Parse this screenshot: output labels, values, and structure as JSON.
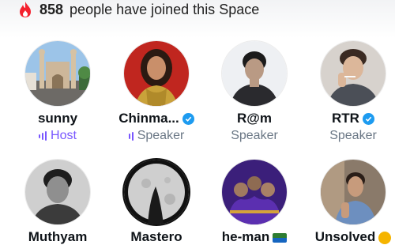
{
  "header": {
    "icon": "flame-icon",
    "count": "858",
    "text": "people have joined this Space"
  },
  "colors": {
    "accent": "#7856ff",
    "verified": "#1d9bf0",
    "muted": "#6a7785"
  },
  "participants": [
    {
      "name": "sunny",
      "role": "Host",
      "verified": false
    },
    {
      "name": "Chinma...",
      "role": "Speaker",
      "verified": true
    },
    {
      "name": "R@m",
      "role": "Speaker",
      "verified": false
    },
    {
      "name": "RTR",
      "role": "Speaker",
      "verified": true
    },
    {
      "name": "Muthyam",
      "role": "",
      "verified": false
    },
    {
      "name": "Mastero",
      "role": "",
      "verified": false
    },
    {
      "name": "he-man",
      "role": "",
      "verified": false
    },
    {
      "name": "Unsolved",
      "role": "",
      "verified": false
    }
  ]
}
